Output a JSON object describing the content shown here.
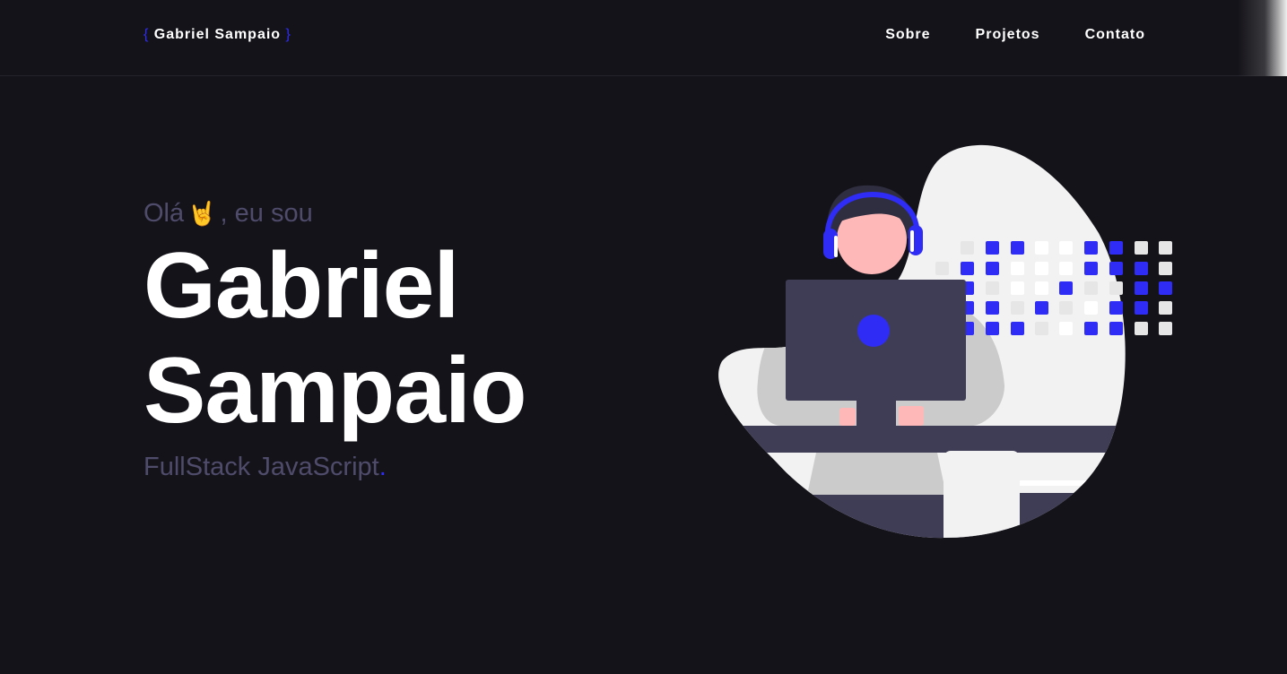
{
  "logo": {
    "open_brace": "{",
    "name": "Gabriel Sampaio",
    "close_brace": "}"
  },
  "nav": {
    "items": [
      "Sobre",
      "Projetos",
      "Contato"
    ]
  },
  "hero": {
    "greeting_prefix": "Olá",
    "greeting_emoji": "🤘",
    "greeting_suffix": ", eu sou",
    "name_line1": "Gabriel",
    "name_line2": "Sampaio",
    "role": "FullStack JavaScript",
    "role_dot": "."
  },
  "colors": {
    "background": "#141319",
    "accent": "#2f2cf5",
    "muted_text": "#4f4b6b"
  },
  "illustration": {
    "icon": "developer-at-computer-illustration"
  }
}
